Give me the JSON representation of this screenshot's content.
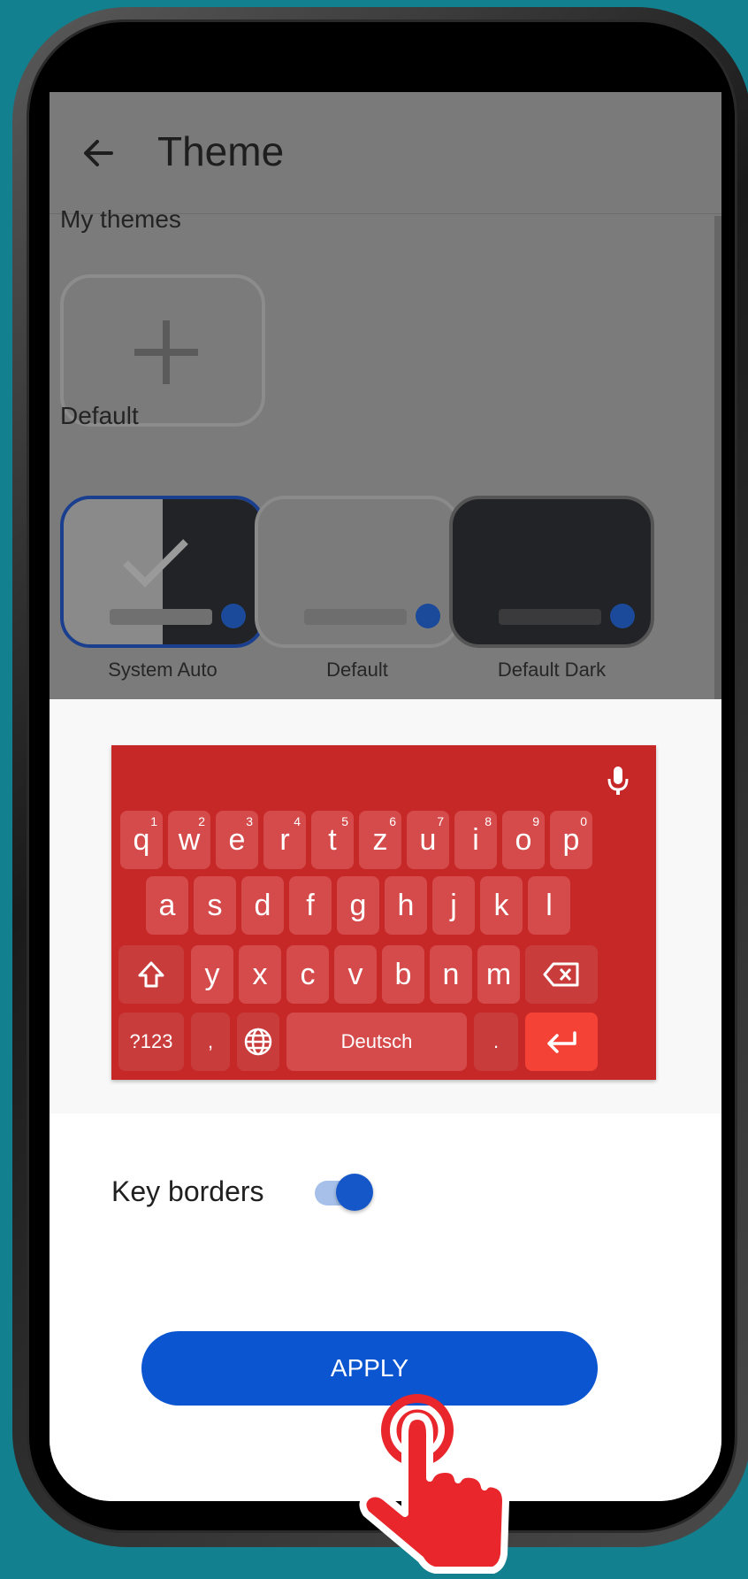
{
  "header": {
    "title": "Theme",
    "back_icon": "arrow-left-icon"
  },
  "my_themes": {
    "label": "My themes",
    "add_icon": "plus-icon"
  },
  "defaults": {
    "label": "Default",
    "themes": [
      {
        "name": "System Auto",
        "selected": true
      },
      {
        "name": "Default",
        "selected": false
      },
      {
        "name": "Default Dark",
        "selected": false
      }
    ]
  },
  "keyboard": {
    "row1": [
      "q",
      "w",
      "e",
      "r",
      "t",
      "z",
      "u",
      "i",
      "o",
      "p"
    ],
    "row1_hints": [
      "1",
      "2",
      "3",
      "4",
      "5",
      "6",
      "7",
      "8",
      "9",
      "0"
    ],
    "row2": [
      "a",
      "s",
      "d",
      "f",
      "g",
      "h",
      "j",
      "k",
      "l"
    ],
    "row3": [
      "y",
      "x",
      "c",
      "v",
      "b",
      "n",
      "m"
    ],
    "symbols_key": "?123",
    "comma_key": ",",
    "space_label": "Deutsch",
    "period_key": ".",
    "colors": {
      "background": "#c62828",
      "key": "#d54b4b",
      "enter": "#f44336"
    }
  },
  "settings": {
    "key_borders_label": "Key borders",
    "key_borders_on": true
  },
  "apply_button": {
    "label": "APPLY"
  },
  "colors": {
    "accent": "#0b55d0",
    "background": "#12808f"
  }
}
